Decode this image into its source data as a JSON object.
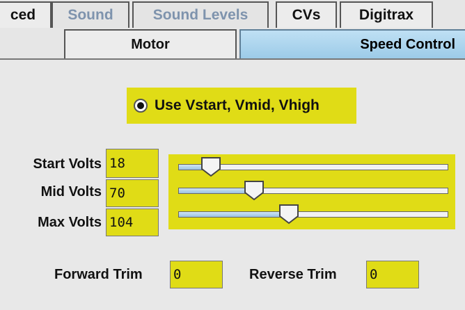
{
  "tabs_row1": [
    {
      "label": "ced",
      "state": "active"
    },
    {
      "label": "Sound",
      "state": "inactive"
    },
    {
      "label": "Sound Levels",
      "state": "inactive"
    },
    {
      "label": "CVs",
      "state": "active"
    },
    {
      "label": "Digitrax",
      "state": "active"
    }
  ],
  "tabs_row2": [
    {
      "label": "Motor"
    },
    {
      "label": "Speed Control"
    }
  ],
  "radio": {
    "label": "Use Vstart, Vmid, Vhigh",
    "selected": true
  },
  "volts": {
    "start": {
      "label": "Start Volts",
      "value": "18",
      "slider": 0.12
    },
    "mid": {
      "label": "Mid Volts",
      "value": "70",
      "slider": 0.28
    },
    "max": {
      "label": "Max Volts",
      "value": "104",
      "slider": 0.41
    }
  },
  "trim": {
    "forward": {
      "label": "Forward Trim",
      "value": "0"
    },
    "reverse": {
      "label": "Reverse Trim",
      "value": "0"
    }
  },
  "colors": {
    "highlight": "#e0dc16",
    "active_tab": "#a8d4ee"
  }
}
